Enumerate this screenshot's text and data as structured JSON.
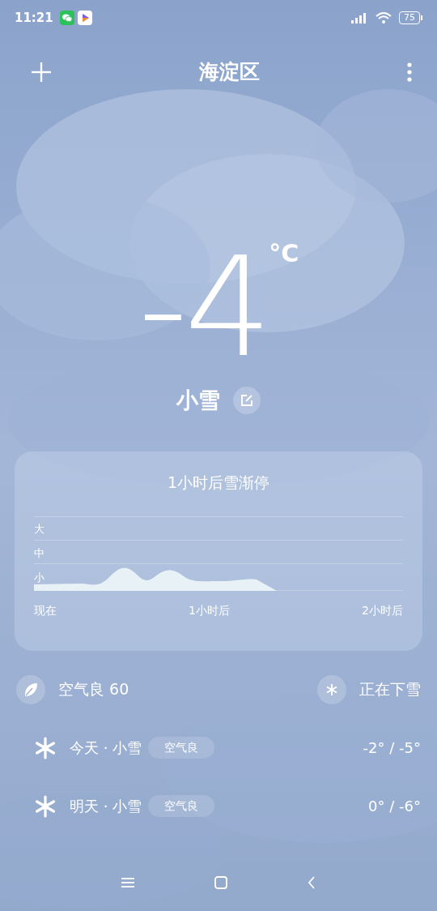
{
  "status_bar": {
    "time": "11:21",
    "battery": "75"
  },
  "header": {
    "city": "海淀区"
  },
  "current": {
    "temperature": "-4",
    "unit": "°C",
    "condition": "小雪"
  },
  "forecast_card": {
    "title": "1小时后雪渐停",
    "y_labels": [
      "大",
      "中",
      "小"
    ],
    "x_labels": [
      "现在",
      "1小时后",
      "2小时后"
    ]
  },
  "info": [
    {
      "kind": "air",
      "text": "空气良 60"
    },
    {
      "kind": "snow",
      "text": "正在下雪"
    }
  ],
  "days": [
    {
      "label": "今天 · 小雪",
      "air": "空气良",
      "range": "-2° / -5°"
    },
    {
      "label": "明天 · 小雪",
      "air": "空气良",
      "range": "0° / -6°"
    }
  ]
}
